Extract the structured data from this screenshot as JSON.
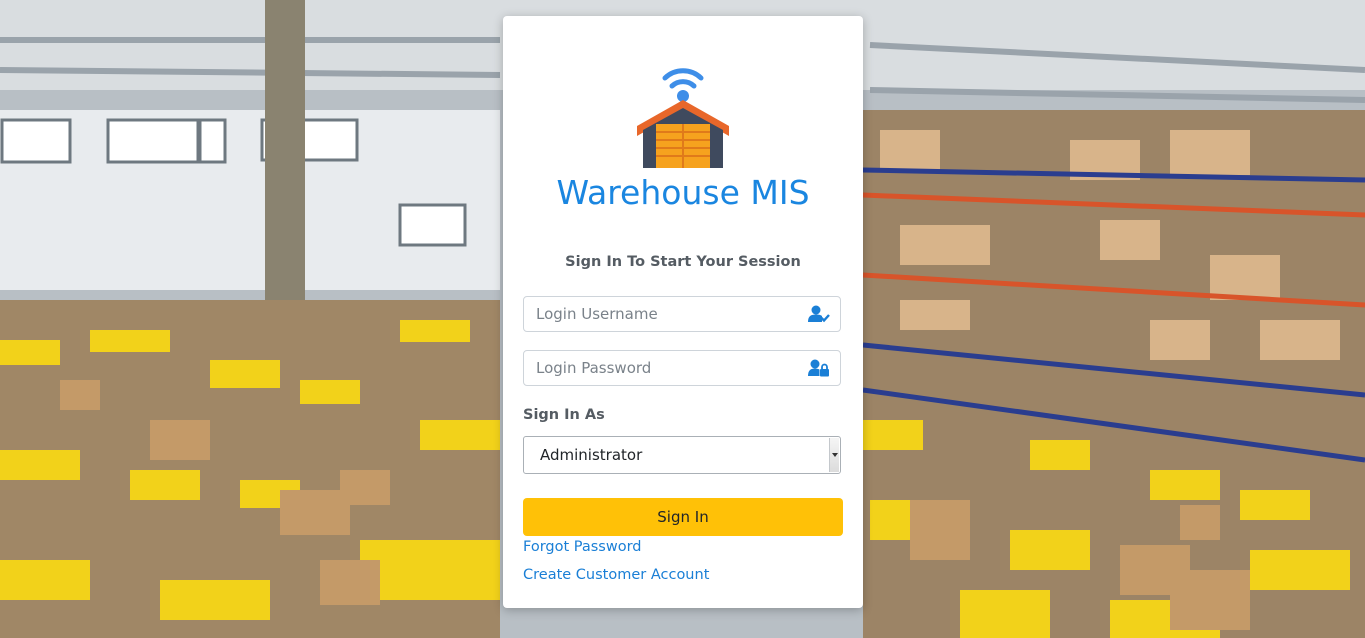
{
  "app": {
    "title": "Warehouse MIS",
    "subtitle": "Sign In To Start Your Session"
  },
  "form": {
    "username_placeholder": "Login Username",
    "password_placeholder": "Login Password",
    "role_label": "Sign In As",
    "role_value": "Administrator",
    "signin_label": "Sign In",
    "forgot_label": "Forgot Password",
    "create_label": "Create Customer Account"
  },
  "icons": {
    "logo": "warehouse-wifi-icon",
    "username": "user-check-icon",
    "password": "user-lock-icon"
  },
  "colors": {
    "brand": "#1a86e0",
    "button": "#ffc107",
    "link": "#1a7fd6"
  }
}
